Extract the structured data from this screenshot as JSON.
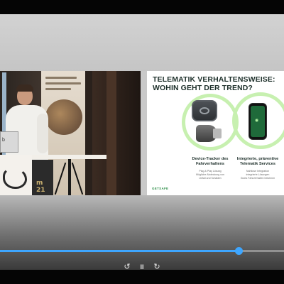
{
  "video": {
    "slide": {
      "title_line1": "TELEMATIK VERHALTENSWEISE:",
      "title_line2": "WOHIN GEHT DER TREND?",
      "column_left_heading_1": "Device-Tracker des",
      "column_left_heading_2": "Fahrverhaltens",
      "column_left_text_1": "Plug & Play Lösung",
      "column_left_text_2": "Mögliche Abdeckung von",
      "column_left_text_3": "Unfall und Schäden",
      "column_right_heading_1": "Integrierte, präventive",
      "column_right_heading_2": "Telematik Services",
      "column_right_text_1": "Nahtlose Integration",
      "column_right_text_2": "integrierte Lösungen",
      "column_right_text_3": "Gutes Fahrverhalten belohnen",
      "brand": "GETSAFE"
    },
    "camera": {
      "laptop_label": "b",
      "podium_badge": "m 21"
    }
  },
  "player": {
    "progress": 0.84,
    "accent_color": "#3ea6ff",
    "controls": [
      {
        "name": "rewind-10-icon",
        "glyph": "↺"
      },
      {
        "name": "pause-icon",
        "glyph": "II"
      },
      {
        "name": "forward-10-icon",
        "glyph": "↻"
      }
    ]
  }
}
